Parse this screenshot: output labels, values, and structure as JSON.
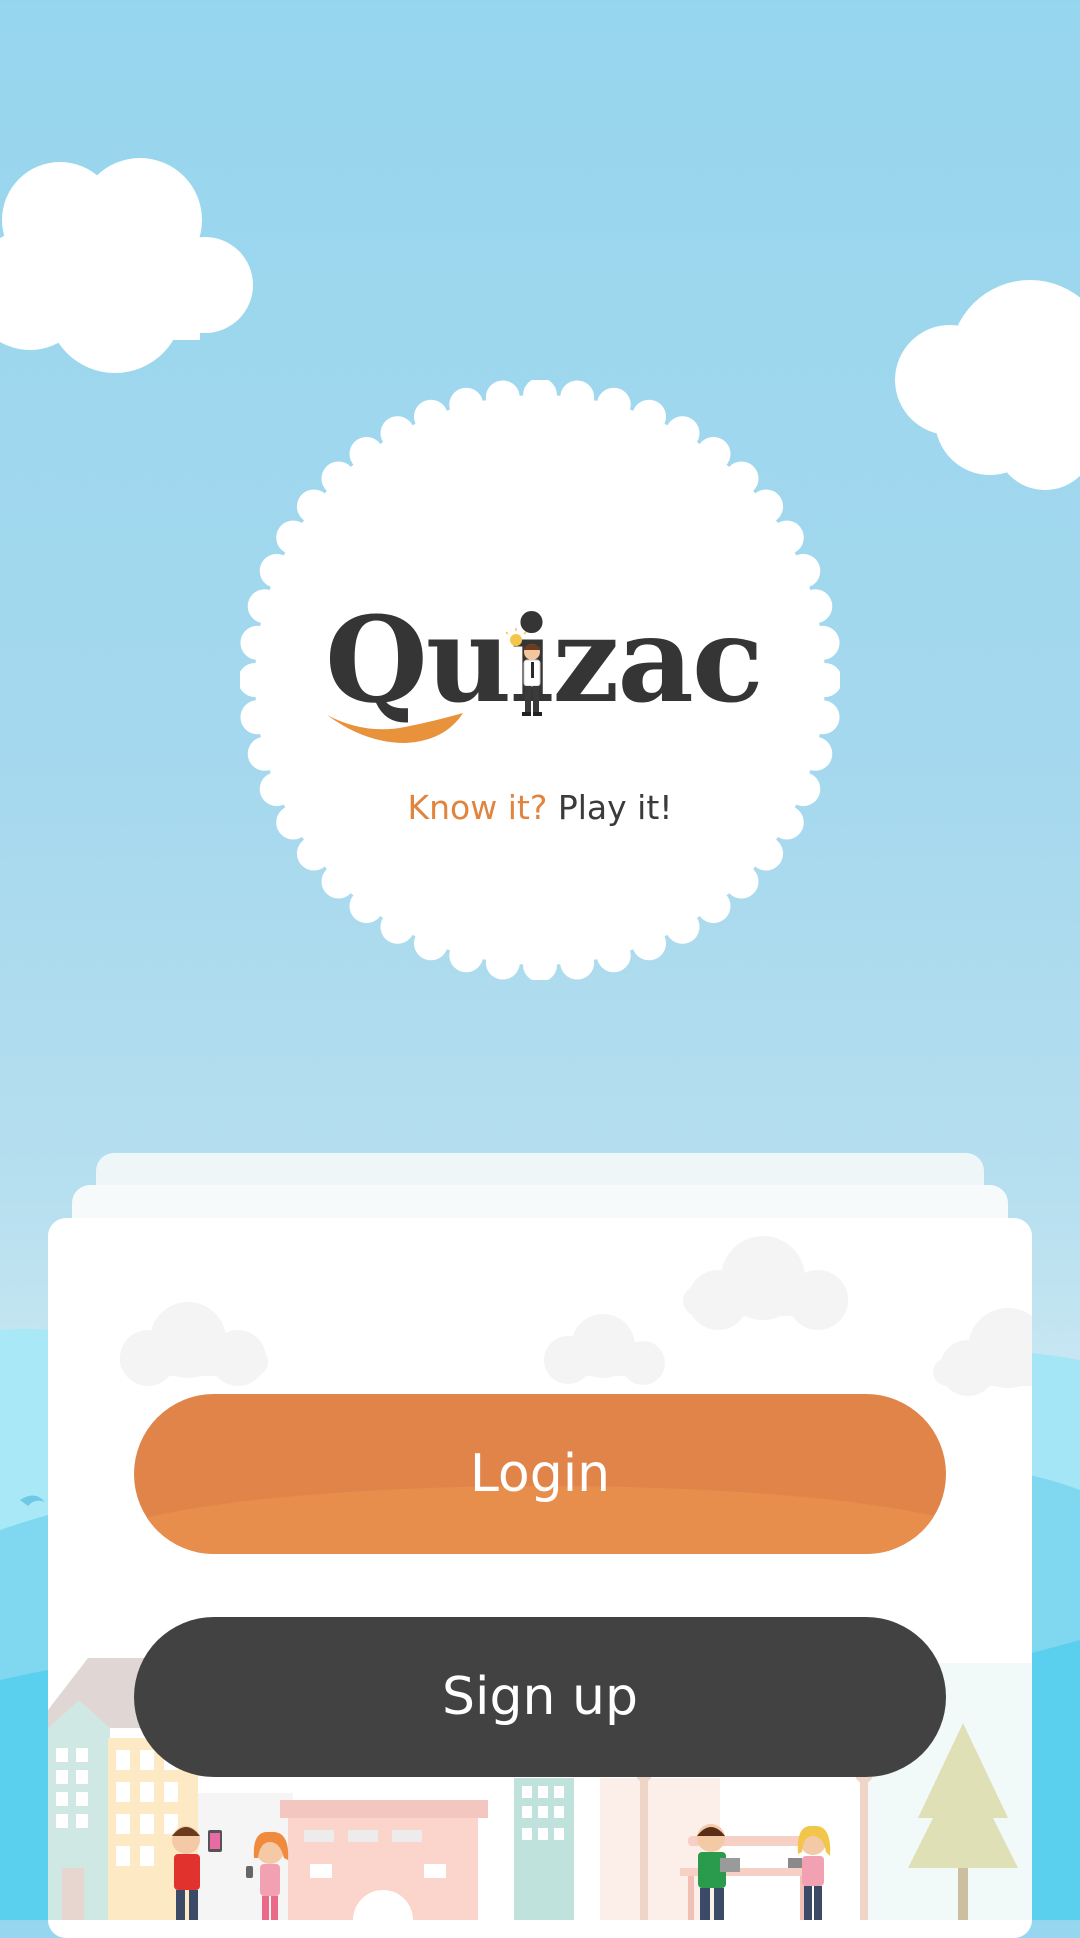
{
  "app": {
    "name": "Quizac",
    "logo_text": "Quizac",
    "tagline_part1": "Know it?",
    "tagline_part2": "Play it!"
  },
  "actions": {
    "login_label": "Login",
    "signup_label": "Sign up"
  },
  "colors": {
    "sky": "#96d6ee",
    "accent_orange": "#e0844a",
    "dark_button": "#424242",
    "card": "#ffffff"
  },
  "icons": [
    "cloud-icon",
    "mascot-icon",
    "lightbulb-icon"
  ]
}
